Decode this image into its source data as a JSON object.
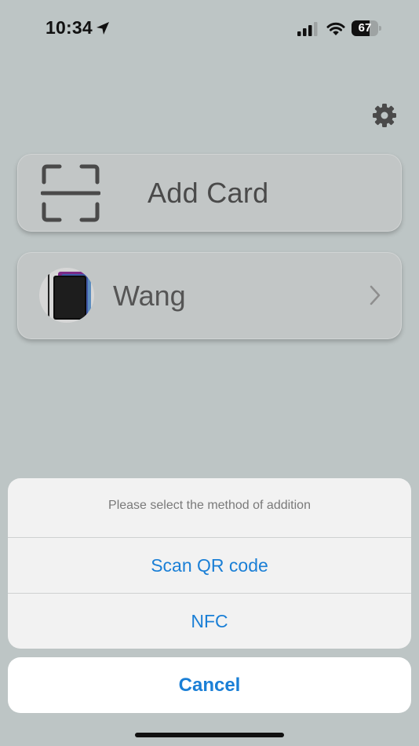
{
  "status_bar": {
    "time": "10:34",
    "battery_percent": "67",
    "battery_level": 0.67,
    "icons": [
      "location-arrow-icon",
      "cellular-signal-icon",
      "wifi-icon",
      "battery-icon"
    ]
  },
  "header": {
    "settings_icon": "gear-icon"
  },
  "cards": {
    "add_card": {
      "label": "Add Card",
      "icon": "scan-frame-icon"
    },
    "items": [
      {
        "label": "Wang",
        "icon": "chevron-right-icon"
      }
    ]
  },
  "action_sheet": {
    "title": "Please select the method of addition",
    "options": [
      {
        "label": "Scan QR code"
      },
      {
        "label": "NFC"
      }
    ],
    "cancel_label": "Cancel"
  },
  "colors": {
    "background": "#bdc5c5",
    "accent": "#1a7fd6",
    "card": "#c2c6c6",
    "sheet": "#f2f2f2"
  }
}
